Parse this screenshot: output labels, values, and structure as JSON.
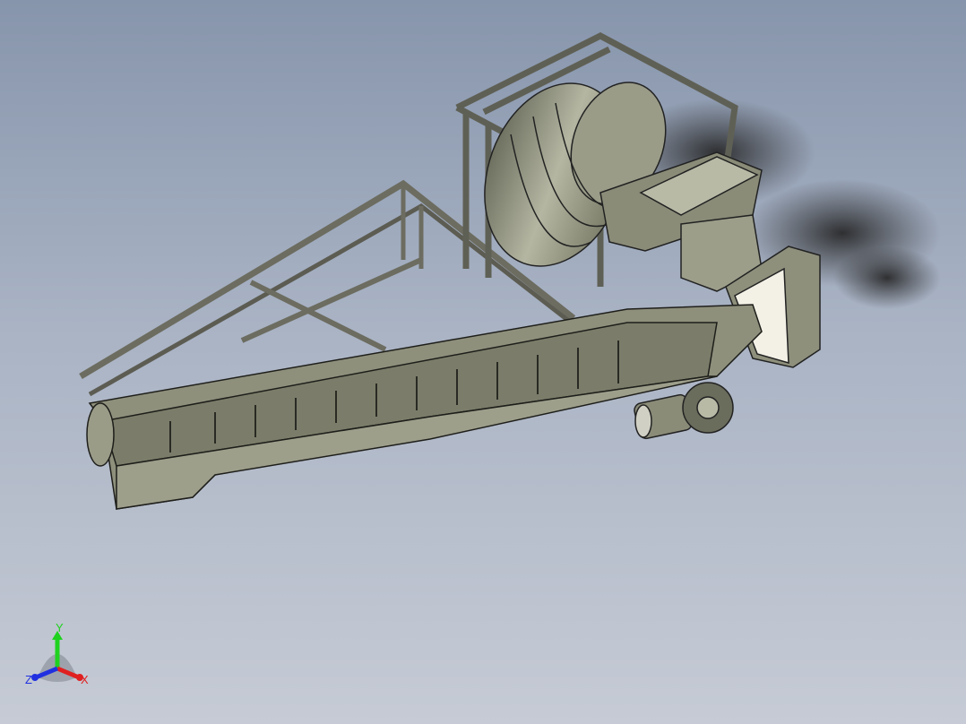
{
  "viewport": {
    "model": "conveyor-drum-assembly",
    "colors": {
      "background_top": "#8795ac",
      "background_bottom": "#c6cbd5",
      "part": "#8a8c78",
      "edge": "#1e1e1a"
    }
  },
  "triad": {
    "x_label": "X",
    "y_label": "Y",
    "z_label": "Z",
    "colors": {
      "x": "#e02020",
      "y": "#1fd21f",
      "z": "#2030e0"
    }
  }
}
